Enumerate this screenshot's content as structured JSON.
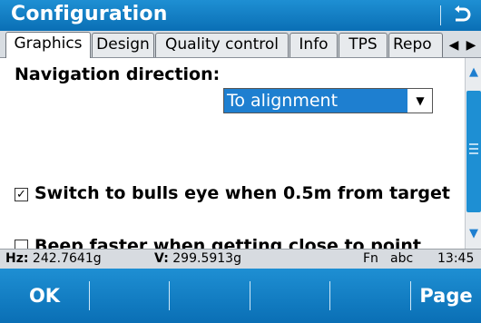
{
  "window": {
    "title": "Configuration",
    "back_icon": "back-arrow-icon"
  },
  "tabs": [
    {
      "label": "Graphics",
      "active": true
    },
    {
      "label": "Design",
      "active": false
    },
    {
      "label": "Quality control",
      "active": false
    },
    {
      "label": "Info",
      "active": false
    },
    {
      "label": "TPS",
      "active": false
    },
    {
      "label": "Repo",
      "active": false
    }
  ],
  "tab_nav": {
    "left": "◀",
    "right": "▶"
  },
  "content": {
    "navigation_label": "Navigation direction:",
    "navigation_value": "To alignment",
    "dropdown_arrow": "▼",
    "checkbox_bulls_eye": {
      "checked": true,
      "mark": "✓",
      "label": "Switch to bulls eye when 0.5m from target"
    },
    "checkbox_beep": {
      "checked": false,
      "mark": "",
      "label": "Beep faster when getting close to point"
    }
  },
  "scrollbar": {
    "up": "▲",
    "down": "▼"
  },
  "status": {
    "hz_label": "Hz:",
    "hz_value": "242.7641g",
    "v_label": "V:",
    "v_value": "299.5913g",
    "fn": "Fn",
    "input_mode": "abc",
    "time": "13:45"
  },
  "softkeys": {
    "f1": "OK",
    "f6": "Page"
  },
  "colors": {
    "accent": "#1e8fd3",
    "selection": "#1e7fd0",
    "bar_bg": "#d7dbe0"
  }
}
